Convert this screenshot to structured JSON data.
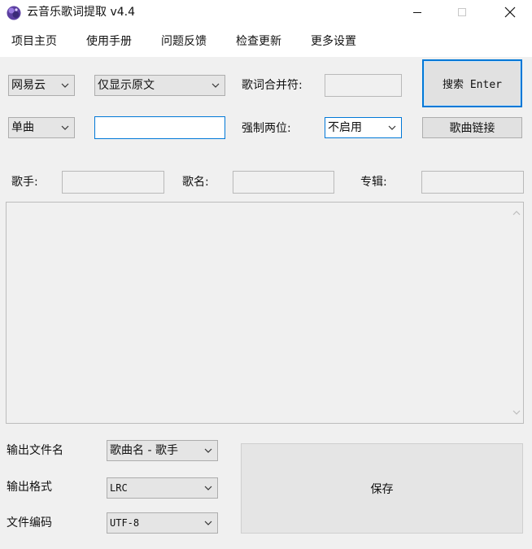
{
  "window": {
    "title": "云音乐歌词提取 v4.4",
    "icon": "purple-orb-app-icon",
    "controls": {
      "minimize": "minimize-icon",
      "maximize": "maximize-icon",
      "close": "close-icon"
    }
  },
  "menu": {
    "items": [
      "项目主页",
      "使用手册",
      "问题反馈",
      "检查更新",
      "更多设置"
    ]
  },
  "search": {
    "source_value": "网易云",
    "display_mode_value": "仅显示原文",
    "merge_char_label": "歌词合并符:",
    "merge_char_value": "",
    "search_button_label": "搜索 Enter",
    "search_type_value": "单曲",
    "query_value": "",
    "force_two_digits_label": "强制两位:",
    "force_two_digits_value": "不启用",
    "song_link_button_label": "歌曲链接"
  },
  "info": {
    "artist_label": "歌手:",
    "artist_value": "",
    "song_label": "歌名:",
    "song_value": "",
    "album_label": "专辑:",
    "album_value": ""
  },
  "lyrics": {
    "content": ""
  },
  "output": {
    "filename_label": "输出文件名",
    "filename_value": "歌曲名 - 歌手",
    "format_label": "输出格式",
    "format_value": "LRC",
    "encoding_label": "文件编码",
    "encoding_value": "UTF-8",
    "save_button_label": "保存"
  },
  "colors": {
    "accent": "#0078d7",
    "window_bg": "#f0f0f0",
    "control_bg": "#e5e5e5"
  }
}
